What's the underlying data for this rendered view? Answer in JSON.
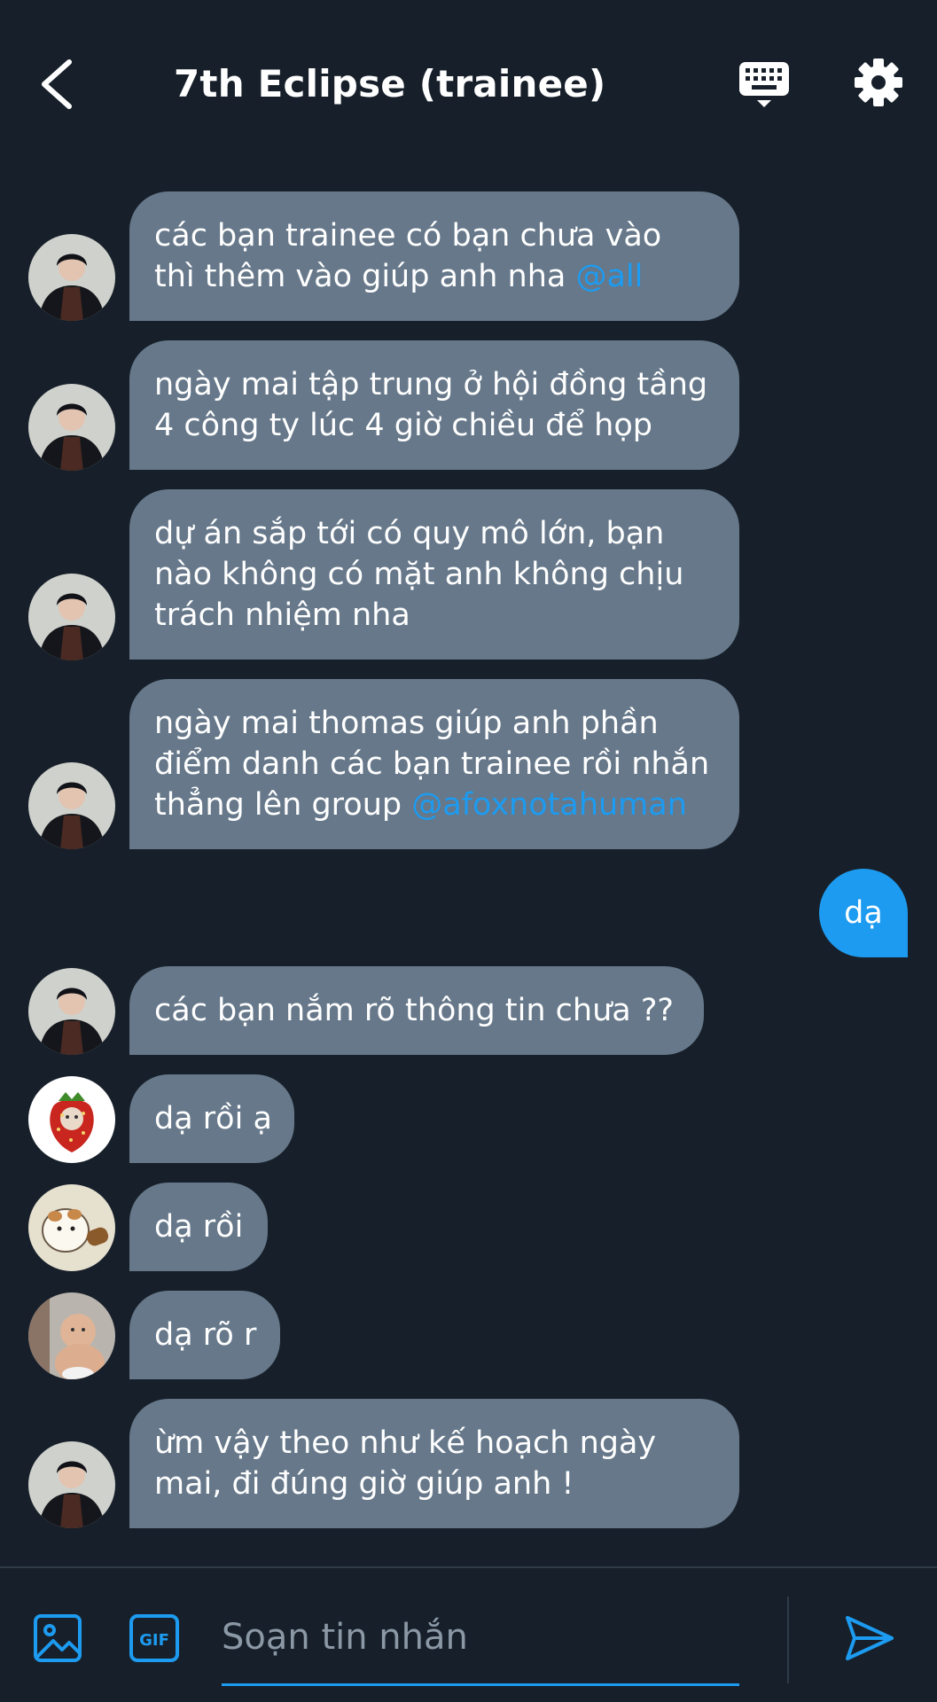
{
  "header": {
    "title": "7th Eclipse (trainee)"
  },
  "messages": [
    {
      "lines": [
        "các bạn trainee có bạn chưa vào",
        "thì thêm vào giúp anh nha "
      ],
      "mention": "@all",
      "sender_avatar": "avatar-dark-suit"
    },
    {
      "lines": [
        "ngày mai tập trung ở hội đồng tầng",
        "4 công ty lúc 4 giờ chiều để họp"
      ],
      "sender_avatar": "avatar-dark-suit"
    },
    {
      "lines": [
        "dự án sắp tới có quy mô lớn, bạn",
        "nào không có mặt anh không chịu",
        "trách nhiệm nha"
      ],
      "sender_avatar": "avatar-dark-suit"
    },
    {
      "lines": [
        "ngày mai thomas giúp anh phần",
        "điểm danh các bạn trainee rồi nhắn",
        "thẳng lên group "
      ],
      "mention": "@afoxnotahuman",
      "sender_avatar": "avatar-dark-suit"
    },
    {
      "lines": [
        "dạ"
      ],
      "mine": true
    },
    {
      "lines": [
        "các bạn nắm rõ thông tin chưa ??"
      ],
      "sender_avatar": "avatar-dark-suit"
    },
    {
      "lines": [
        "dạ rồi ạ"
      ],
      "sender_avatar": "avatar-strawberry"
    },
    {
      "lines": [
        "dạ rồi"
      ],
      "sender_avatar": "avatar-hamster"
    },
    {
      "lines": [
        "dạ rõ r"
      ],
      "sender_avatar": "avatar-baby"
    },
    {
      "lines": [
        "ừm vậy theo như kế hoạch ngày",
        "mai, đi đúng giờ giúp anh !"
      ],
      "sender_avatar": "avatar-dark-suit"
    }
  ],
  "composer": {
    "placeholder": "Soạn tin nhắn",
    "gif_label": "GIF"
  },
  "colors": {
    "background": "#17202a",
    "incoming_bubble": "#66788a",
    "outgoing_bubble": "#1d9bf0",
    "accent": "#1d9bf0"
  },
  "icons": [
    "back-arrow-icon",
    "keyboard-icon",
    "gear-icon",
    "image-icon",
    "gif-icon",
    "send-icon"
  ]
}
